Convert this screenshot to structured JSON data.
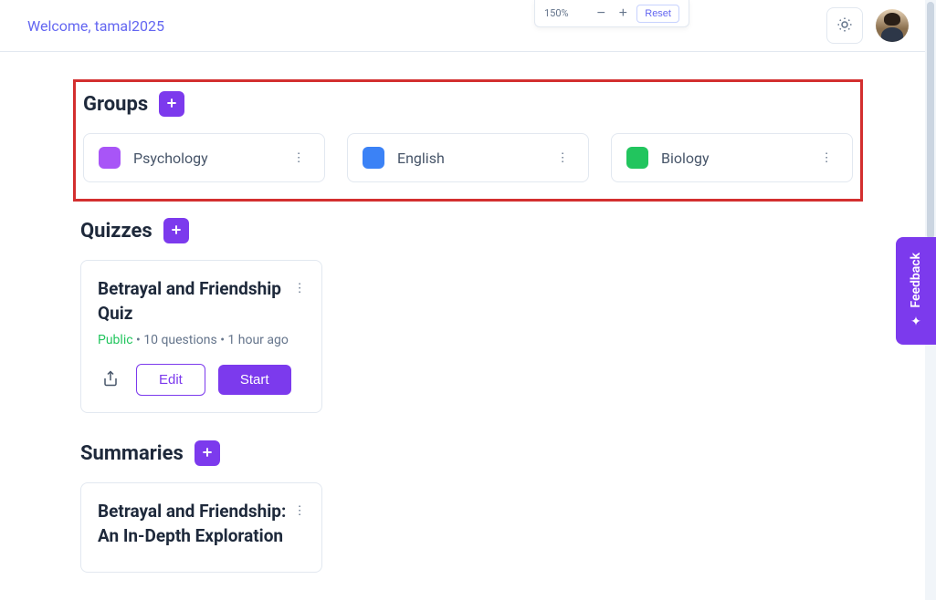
{
  "zoom": {
    "value": "150%",
    "reset": "Reset"
  },
  "header": {
    "welcome": "Welcome, tamal2025"
  },
  "groups": {
    "title": "Groups",
    "items": [
      {
        "name": "Psychology",
        "color": "#a855f7"
      },
      {
        "name": "English",
        "color": "#3b82f6"
      },
      {
        "name": "Biology",
        "color": "#22c55e"
      }
    ]
  },
  "quizzes": {
    "title": "Quizzes",
    "items": [
      {
        "title": "Betrayal and Friendship Quiz",
        "visibility": "Public",
        "questions": "10 questions",
        "age": "1 hour ago",
        "edit": "Edit",
        "start": "Start"
      }
    ]
  },
  "summaries": {
    "title": "Summaries",
    "items": [
      {
        "title": "Betrayal and Friendship: An In-Depth Exploration"
      }
    ]
  },
  "feedback": {
    "label": "Feedback"
  }
}
